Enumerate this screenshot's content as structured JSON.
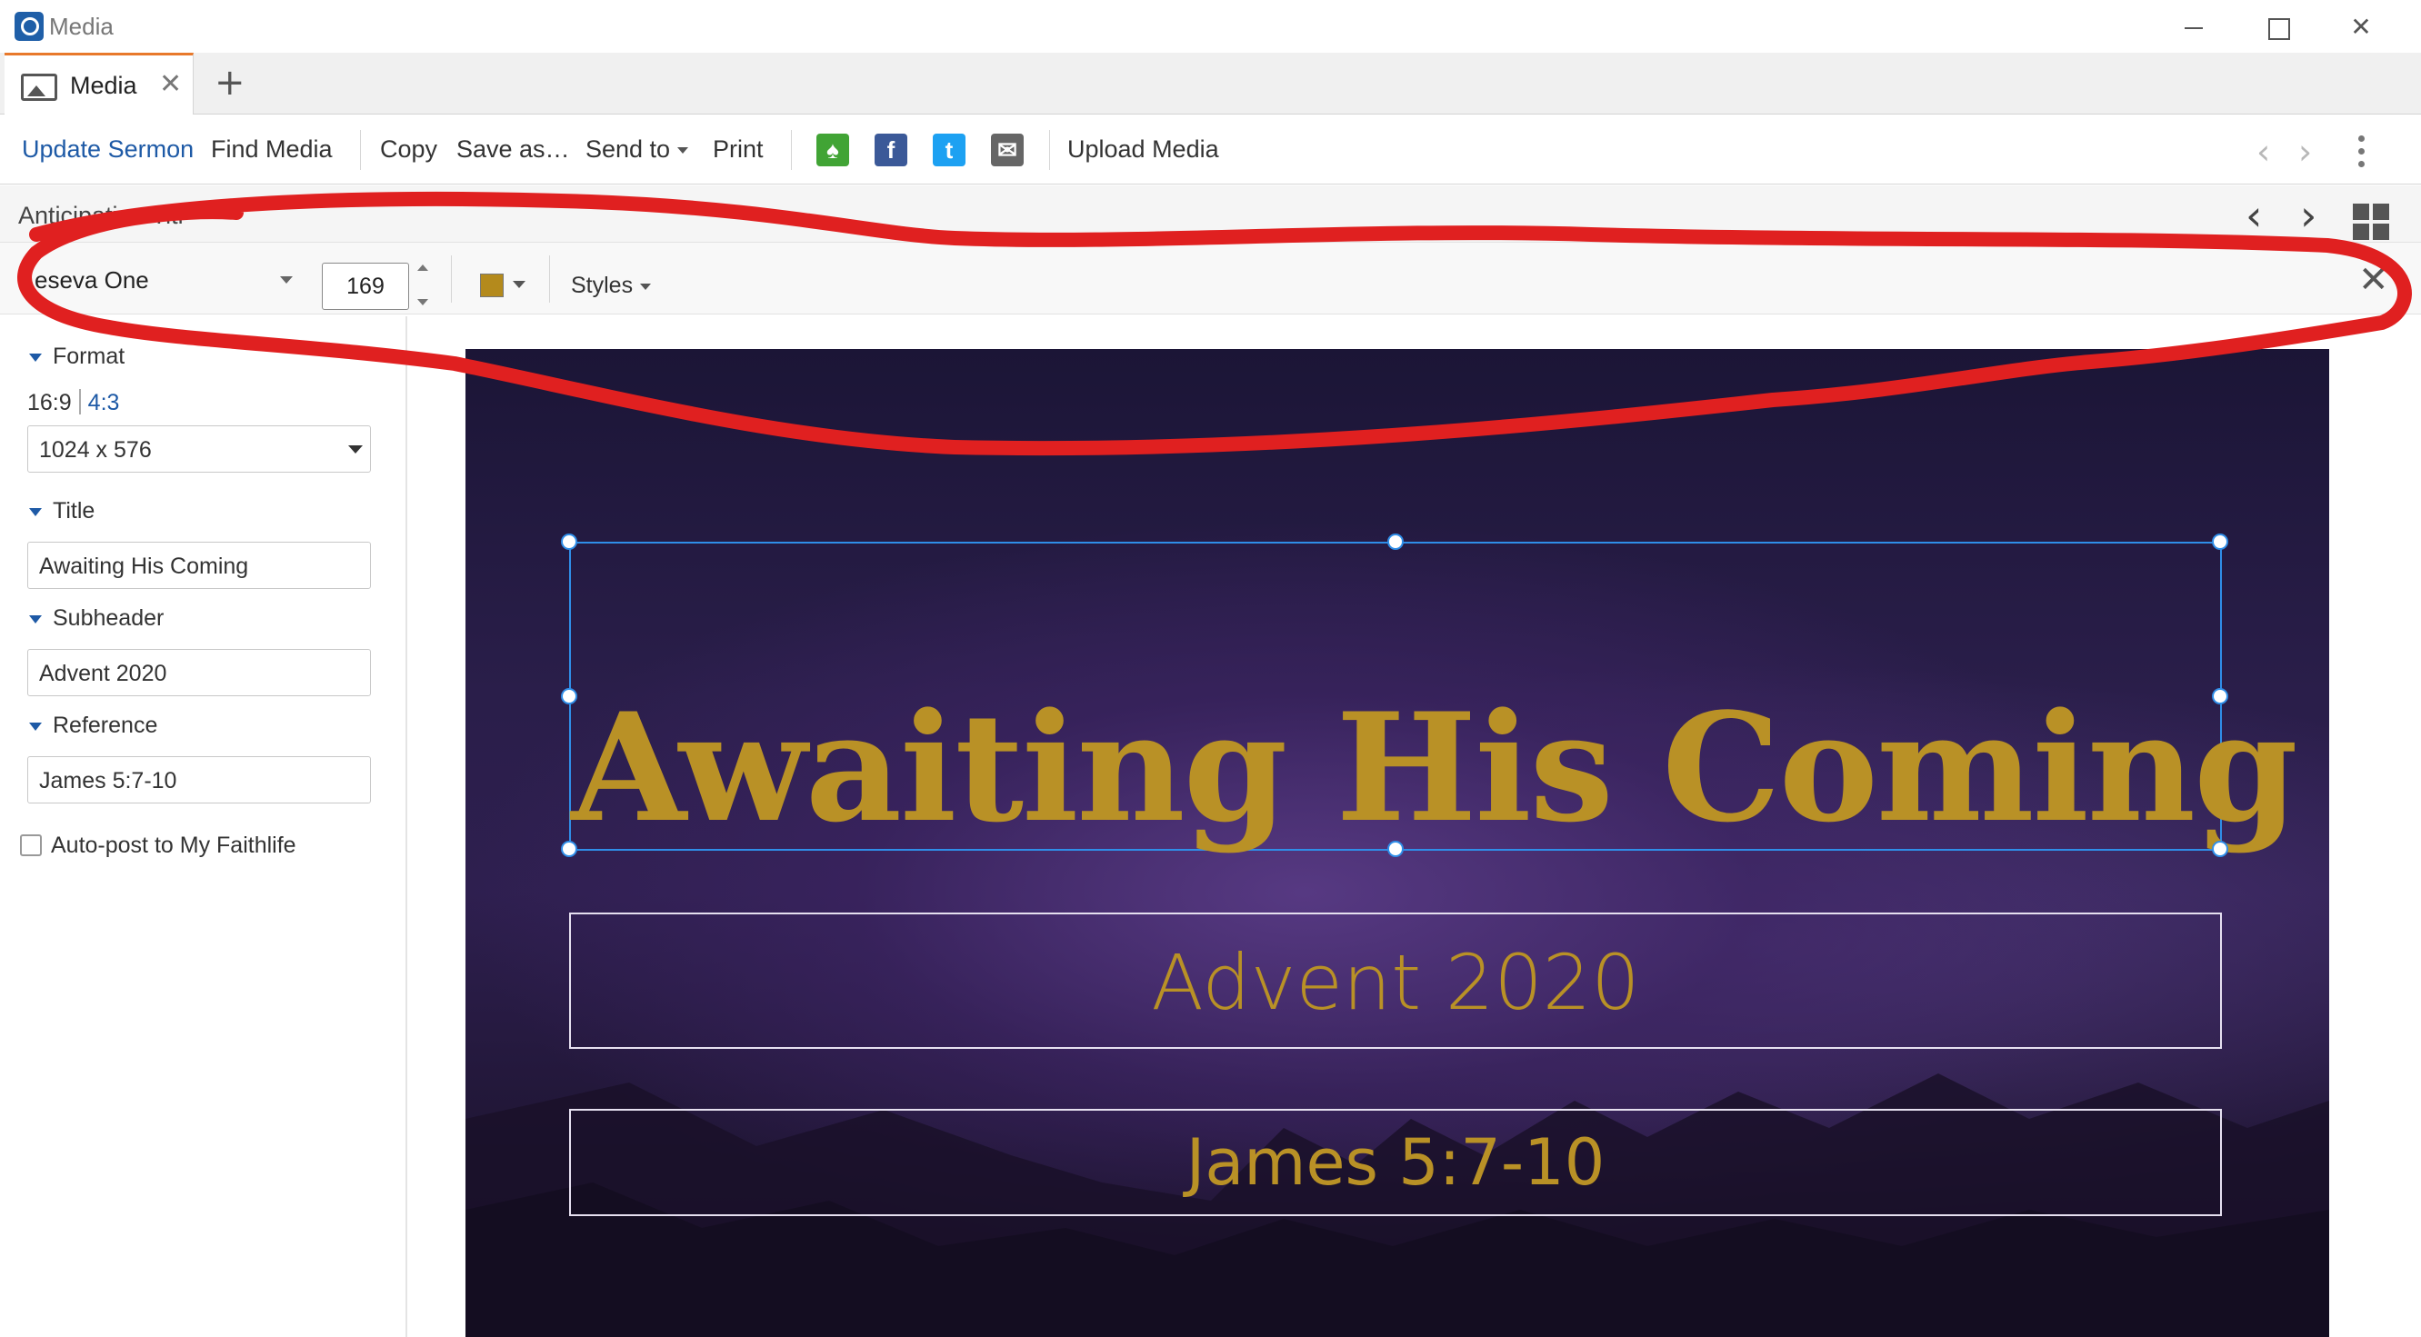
{
  "window": {
    "title": "Media",
    "controls": {
      "minimize": "minimize",
      "maximize": "maximize",
      "close": "✕"
    }
  },
  "tabs": [
    {
      "label": "Media",
      "close": "✕"
    }
  ],
  "tab_add": "+",
  "toolbar": {
    "update_sermon": "Update Sermon",
    "find_media": "Find Media",
    "copy": "Copy",
    "save_as": "Save as…",
    "send_to": "Send to",
    "print": "Print",
    "upload_media": "Upload Media",
    "share": {
      "faithlife": "♠",
      "facebook": "f",
      "twitter": "t",
      "email": "✉"
    }
  },
  "doc_bar": {
    "title": "Anticipation Titl",
    "prev": "‹",
    "next": "›"
  },
  "format_bar": {
    "font": "eseva One",
    "size": "169",
    "color": "#b48a1c",
    "styles": "Styles",
    "close": "✕"
  },
  "left_panel": {
    "format": {
      "heading": "Format",
      "ratio_a": "16:9",
      "ratio_b": "4:3",
      "resolution": "1024 x 576"
    },
    "title": {
      "heading": "Title",
      "value": "Awaiting His Coming"
    },
    "subheader": {
      "heading": "Subheader",
      "value": "Advent 2020"
    },
    "reference": {
      "heading": "Reference",
      "value": "James 5:7-10"
    },
    "autopost": {
      "label": "Auto-post to My Faithlife",
      "checked": false
    }
  },
  "slide": {
    "title": "Awaiting His Coming",
    "subheader": "Advent 2020",
    "reference": "James 5:7-10",
    "accent_color": "#b99126"
  },
  "annotation": {
    "color": "#e02020"
  }
}
